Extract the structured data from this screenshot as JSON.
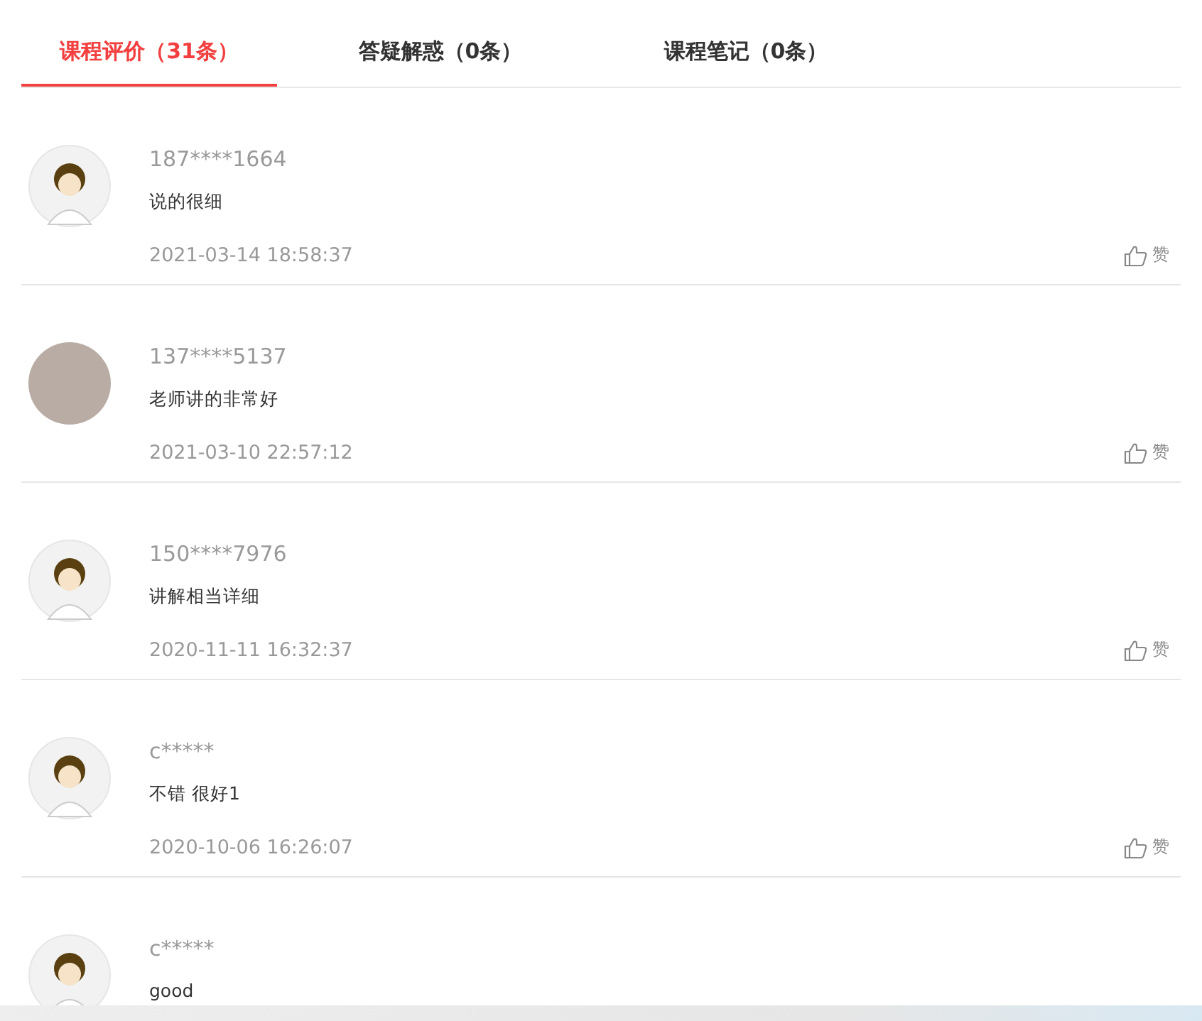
{
  "tabs": [
    {
      "label": "课程评价（31条）",
      "selected": true
    },
    {
      "label": "答疑解惑（0条）",
      "selected": false
    },
    {
      "label": "课程笔记（0条）",
      "selected": false
    }
  ],
  "comments": [
    {
      "user": "187****1664",
      "avatar": {
        "kind": "cartoon"
      },
      "text": "说的很细",
      "time": "2021-03-14 18:58:37",
      "like": "赞"
    },
    {
      "user": "137****5137",
      "avatar": {
        "kind": "photo"
      },
      "text": "老师讲的非常好",
      "time": "2021-03-10 22:57:12",
      "like": "赞"
    },
    {
      "user": "150****7976",
      "avatar": {
        "kind": "cartoon"
      },
      "text": "讲解相当详细",
      "time": "2020-11-11 16:32:37",
      "like": "赞"
    },
    {
      "user": "c*****",
      "avatar": {
        "kind": "cartoon"
      },
      "text": "不错 很好1",
      "time": "2020-10-06 16:26:07",
      "like": "赞"
    },
    {
      "user": "c*****",
      "avatar": {
        "kind": "cartoon"
      },
      "text": "good"
    }
  ]
}
